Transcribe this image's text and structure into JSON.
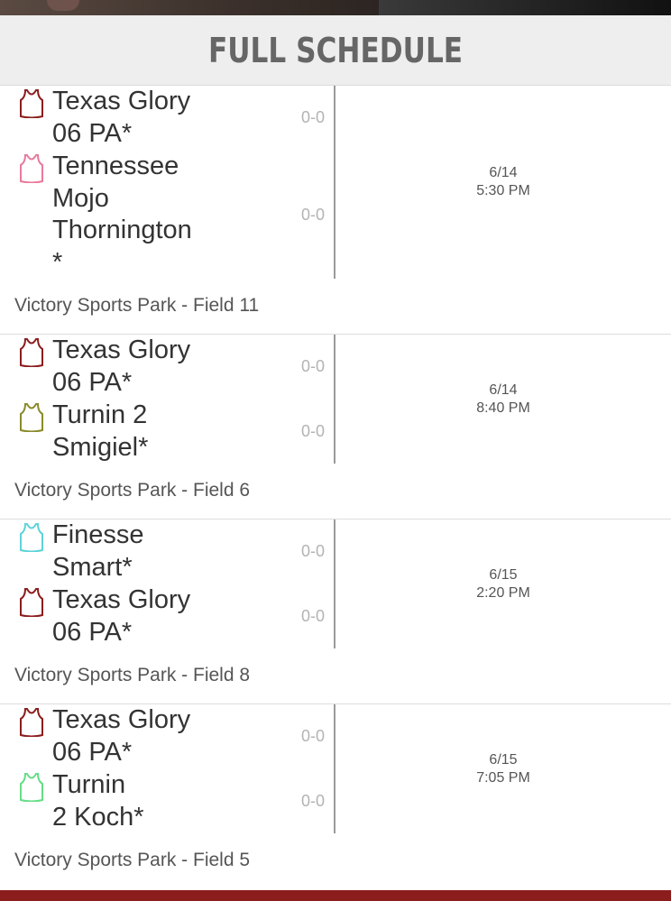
{
  "header": {
    "title": "FULL SCHEDULE"
  },
  "colors": {
    "maroon": "#8b1d1d",
    "pink": "#e87a9c",
    "olive": "#8a8a2a",
    "cyan": "#5fd3d8",
    "green": "#66dd88"
  },
  "games": [
    {
      "team1": {
        "name": "Texas Glory\n06 PA*",
        "record": "0-0",
        "icon": "jersey-icon",
        "color": "#8b1d1d"
      },
      "team2": {
        "name": "Tennessee\nMojo\nThornington\n*",
        "record": "0-0",
        "icon": "jersey-icon",
        "color": "#e87a9c"
      },
      "date": "6/14",
      "time": "5:30 PM",
      "venue": "Victory Sports Park - Field 11"
    },
    {
      "team1": {
        "name": "Texas Glory\n06 PA*",
        "record": "0-0",
        "icon": "jersey-icon",
        "color": "#8b1d1d"
      },
      "team2": {
        "name": "Turnin 2\nSmigiel*",
        "record": "0-0",
        "icon": "jersey-icon",
        "color": "#8a8a2a"
      },
      "date": "6/14",
      "time": "8:40 PM",
      "venue": "Victory Sports Park - Field 6"
    },
    {
      "team1": {
        "name": "Finesse\nSmart*",
        "record": "0-0",
        "icon": "jersey-icon",
        "color": "#5fd3d8"
      },
      "team2": {
        "name": "Texas Glory\n06 PA*",
        "record": "0-0",
        "icon": "jersey-icon",
        "color": "#8b1d1d"
      },
      "date": "6/15",
      "time": "2:20 PM",
      "venue": "Victory Sports Park - Field 8"
    },
    {
      "team1": {
        "name": "Texas Glory\n06 PA*",
        "record": "0-0",
        "icon": "jersey-icon",
        "color": "#8b1d1d"
      },
      "team2": {
        "name": "Turnin\n2 Koch*",
        "record": "0-0",
        "icon": "jersey-icon",
        "color": "#66dd88"
      },
      "date": "6/15",
      "time": "7:05 PM",
      "venue": "Victory Sports Park - Field 5"
    }
  ]
}
